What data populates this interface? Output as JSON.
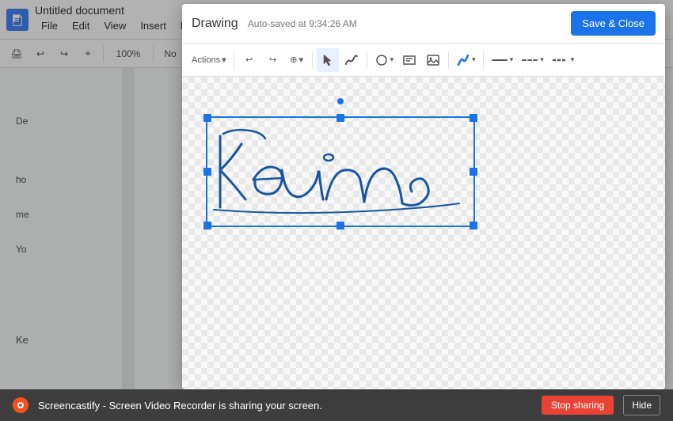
{
  "docs": {
    "title": "Untitled document",
    "menu": {
      "file": "File",
      "edit": "Edit",
      "view": "View",
      "insert": "Insert",
      "format": "Format"
    },
    "toolbar": {
      "zoom": "100%",
      "normal": "No"
    }
  },
  "drawing": {
    "title": "Drawing",
    "autosaved": "Auto-saved at 9:34:26 AM",
    "save_close": "Save & Close",
    "toolbar": {
      "actions": "Actions",
      "undo": "↩",
      "redo": "↪",
      "zoom": "⊕"
    }
  },
  "notification": {
    "text": "Screencastify - Screen Video Recorder is sharing your screen.",
    "stop_sharing": "Stop sharing",
    "hide": "Hide"
  },
  "icons": {
    "docs_logo": "≡",
    "undo": "↩",
    "redo": "↪",
    "print": "🖨",
    "pointer": "↖",
    "paint": "✏",
    "shapes": "◯",
    "textbox": "T",
    "image": "🖼",
    "line_color": "─",
    "line_style": "─",
    "line_weight": "─",
    "chevron": "▾"
  }
}
